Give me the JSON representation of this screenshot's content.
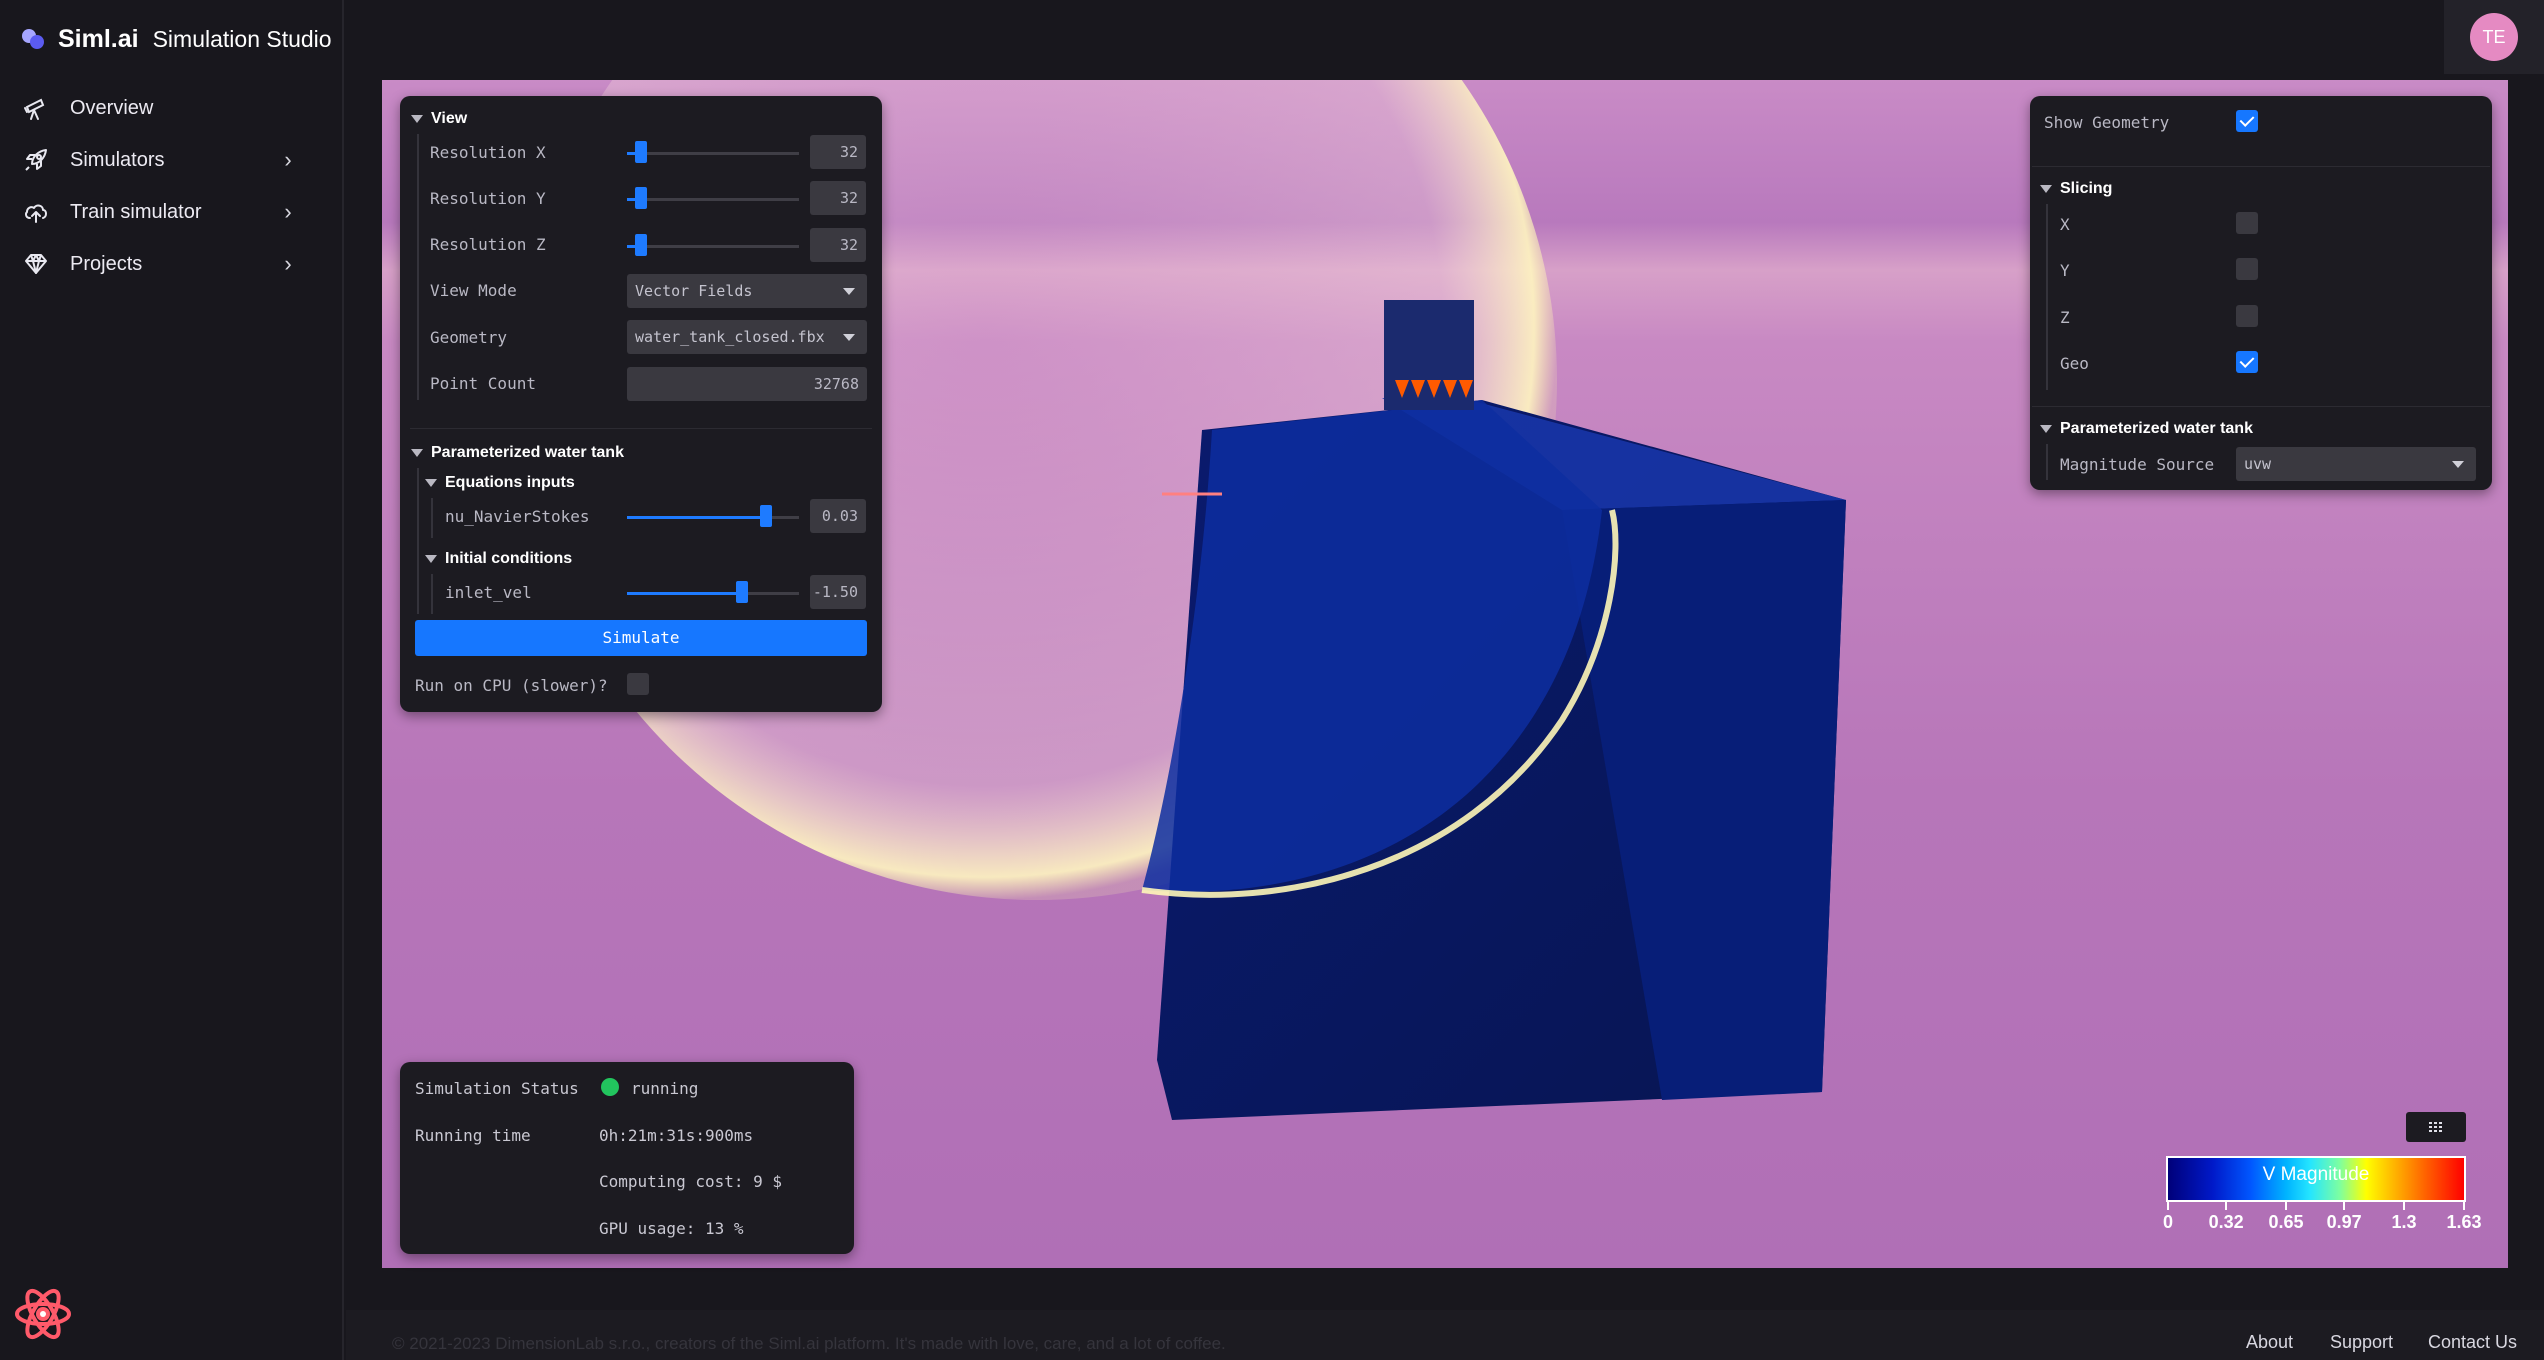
{
  "brand": {
    "name": "Siml.ai",
    "product": "Simulation Studio"
  },
  "user": {
    "initials": "TE"
  },
  "sidebar": {
    "items": [
      {
        "label": "Overview",
        "icon": "telescope-icon",
        "chevron": false
      },
      {
        "label": "Simulators",
        "icon": "rocket-icon",
        "chevron": true
      },
      {
        "label": "Train simulator",
        "icon": "cloud-upload-icon",
        "chevron": true
      },
      {
        "label": "Projects",
        "icon": "diamond-icon",
        "chevron": true
      }
    ]
  },
  "view_panel": {
    "title": "View",
    "resolution_x": {
      "label": "Resolution X",
      "value": "32",
      "fraction": 0.08
    },
    "resolution_y": {
      "label": "Resolution Y",
      "value": "32",
      "fraction": 0.08
    },
    "resolution_z": {
      "label": "Resolution Z",
      "value": "32",
      "fraction": 0.08
    },
    "view_mode": {
      "label": "View Mode",
      "value": "Vector Fields"
    },
    "geometry": {
      "label": "Geometry",
      "value": "water_tank_closed.fbx"
    },
    "point_count": {
      "label": "Point Count",
      "value": "32768"
    },
    "param_title": "Parameterized water tank",
    "equations_title": "Equations inputs",
    "nu": {
      "label": "nu_NavierStokes",
      "value": "0.03",
      "fraction": 0.81
    },
    "initial_title": "Initial conditions",
    "inlet": {
      "label": "inlet_vel",
      "value": "-1.50",
      "fraction": 0.67
    },
    "simulate_label": "Simulate",
    "cpu_label": "Run on CPU (slower)?",
    "cpu_checked": false
  },
  "right_panel": {
    "show_geometry_label": "Show Geometry",
    "show_geometry": true,
    "slicing_title": "Slicing",
    "slices": [
      {
        "label": "X",
        "checked": false
      },
      {
        "label": "Y",
        "checked": false
      },
      {
        "label": "Z",
        "checked": false
      },
      {
        "label": "Geo",
        "checked": true
      }
    ],
    "param_title": "Parameterized water tank",
    "magnitude_label": "Magnitude Source",
    "magnitude_value": "uvw"
  },
  "status_panel": {
    "status_label": "Simulation Status",
    "status_value": "running",
    "running_label": "Running time",
    "running_value": "0h:21m:31s:900ms",
    "cost": "Computing cost: 9 $",
    "gpu": "GPU usage: 13 %"
  },
  "legend": {
    "title": "V Magnitude",
    "ticks": [
      "0",
      "0.32",
      "0.65",
      "0.97",
      "1.3",
      "1.63"
    ]
  },
  "footer": {
    "copyright": "© 2021-2023 DimensionLab s.r.o., creators of the Siml.ai platform. It's made with love, care, and a lot of coffee.",
    "links": [
      "About",
      "Support",
      "Contact Us"
    ]
  },
  "colors": {
    "accent": "#1677ff",
    "running": "#22c55e",
    "avatar": "#e58ac2"
  }
}
